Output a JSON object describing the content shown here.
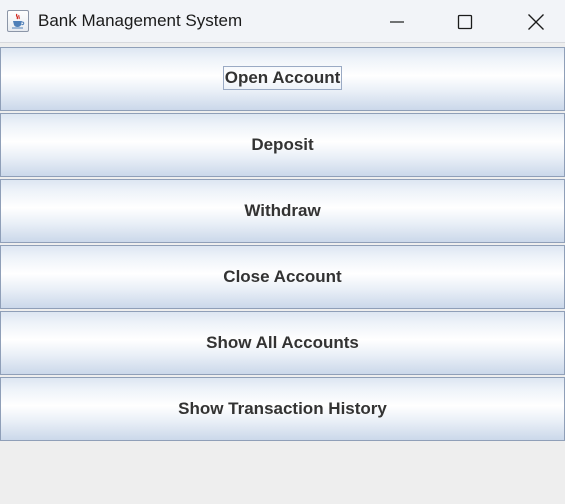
{
  "window": {
    "title": "Bank Management System",
    "icon": "java-cup-icon",
    "controls": [
      "minimize-icon",
      "maximize-icon",
      "close-icon"
    ]
  },
  "menu": {
    "buttons": [
      {
        "label": "Open Account",
        "focused": true
      },
      {
        "label": "Deposit",
        "focused": false
      },
      {
        "label": "Withdraw",
        "focused": false
      },
      {
        "label": "Close Account",
        "focused": false
      },
      {
        "label": "Show All Accounts",
        "focused": false
      },
      {
        "label": "Show Transaction History",
        "focused": false
      }
    ]
  },
  "colors": {
    "background": "#eeeeee",
    "titlebar": "#f2f4f8",
    "button_border": "#8f9fb8",
    "button_text": "#333333"
  }
}
